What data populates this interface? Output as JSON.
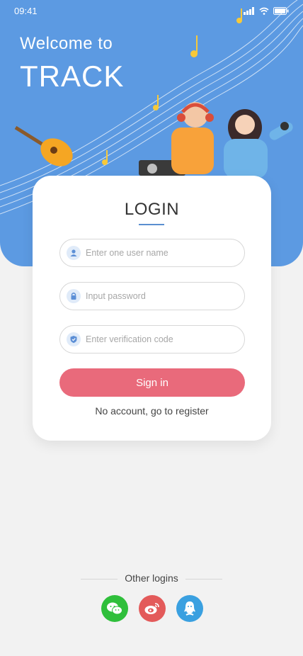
{
  "status_bar": {
    "time": "09:41"
  },
  "hero": {
    "welcome": "Welcome to",
    "brand": "TRACK"
  },
  "login": {
    "title": "LOGIN",
    "username_placeholder": "Enter one user name",
    "password_placeholder": "Input password",
    "code_placeholder": "Enter verification code",
    "sign_in_label": "Sign in",
    "register_link": "No account, go to register"
  },
  "other_logins": {
    "label": "Other logins",
    "providers": [
      {
        "icon": "wechat-icon",
        "color": "#2fbf3b"
      },
      {
        "icon": "weibo-icon",
        "color": "#e35a5a"
      },
      {
        "icon": "qq-icon",
        "color": "#3aa0e0"
      }
    ]
  },
  "colors": {
    "primary": "#5c9ae2",
    "accent": "#e96a7b",
    "card": "#ffffff"
  }
}
